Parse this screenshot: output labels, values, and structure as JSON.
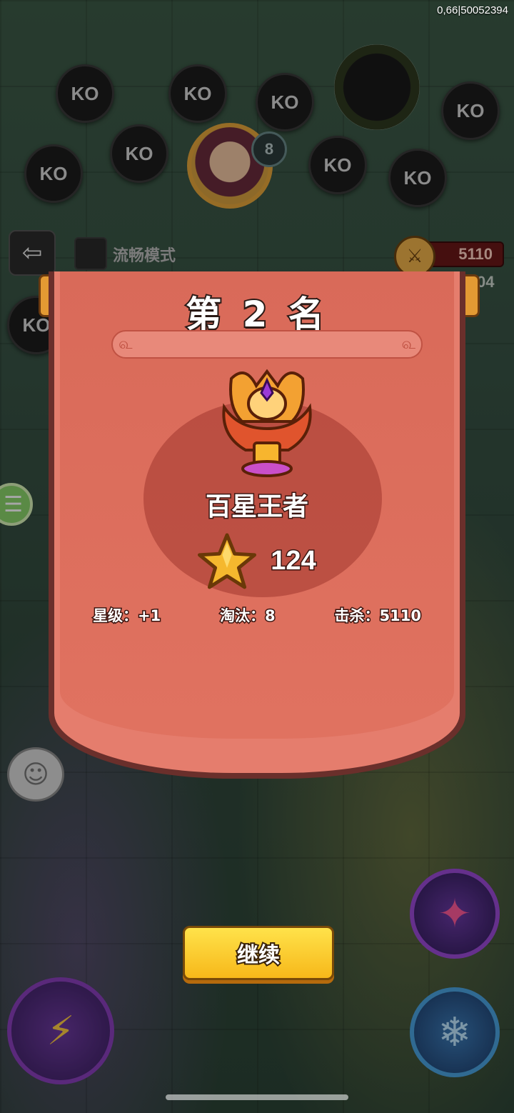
{
  "status": {
    "version_text": "0,66|50052394"
  },
  "battlefield": {
    "ko_label": "KO",
    "player_level": "8",
    "smooth_mode_label": "流畅模式",
    "score_value": "5110",
    "side_number": "04"
  },
  "result": {
    "rank_label": "第 2 名",
    "title": "百星王者",
    "star_count": "124",
    "stats": [
      {
        "text": "星级：+1"
      },
      {
        "text": "淘汰：8"
      },
      {
        "text": "击杀：5110"
      }
    ],
    "continue_label": "继续"
  },
  "icons": {
    "back": "back-arrow-icon",
    "menu": "menu-icon",
    "chat": "emoji-chat-icon",
    "star": "star-icon",
    "trophy": "dragon-trophy-icon"
  },
  "colors": {
    "panel_red": "#e07260",
    "button_yellow": "#f7b81a",
    "star_gold": "#f5b82e"
  }
}
